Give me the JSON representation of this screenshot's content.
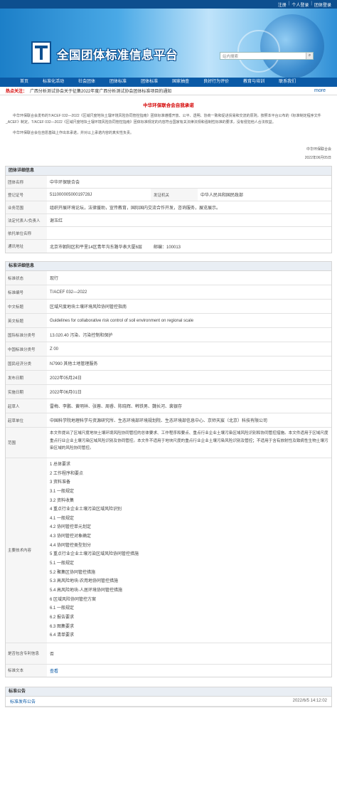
{
  "top_links": [
    "注册",
    "个人登录",
    "团体登录"
  ],
  "site_title": "全国团体标准信息平台",
  "search": {
    "placeholder": "站内搜索"
  },
  "nav": [
    "首页",
    "标准化活动",
    "社会团体",
    "团体标准",
    "团体标准",
    "国家抽查",
    "良好行为评价",
    "教育与培训",
    "联系我们"
  ],
  "hot": {
    "label": "热点关注：",
    "text": "广西分析测试协会关于征集2022年度广西分析测试协会团体标准项目的通知",
    "more": "more"
  },
  "pledge": {
    "title": "中华环保联合会自我承诺",
    "p1": "中华环保联合会发布的T/ACEF 032—2022《区域尺度地块土壤环境风险协同管控指南》团体标准遵循开放、公平、透明、协商一致和促进贸易和交流的原则，按照本平台公布的《标准制定程序文件_ACEF》制定。T/ACEF 032—2022《区域尺度地块土壤环境风险协同管控指南》团体标准规定的内容符合国家有关法律法规和强制性标准的要求，没有侵犯他人合法权益。",
    "p2": "中华环保联合会在自愿基础上作出本承诺，并对以上承诺内容的真实性负责。",
    "org": "中华环保联合会",
    "date": "2022年06月05日"
  },
  "group_info": {
    "title": "团体详细信息",
    "rows": [
      {
        "k": "团体名称",
        "v": "中华环保联合会"
      },
      {
        "k": "登记证号",
        "v": "51100000500019728J",
        "k2": "发证机关",
        "v2": "中华人民共和国民政部"
      },
      {
        "k": "业务范围",
        "v": "组织开展环境论坛，法律援助，宣传教育，国际国内交流合作开发，咨询服务，展览展示。"
      },
      {
        "k": "法定代表人/负责人",
        "v": "谢玉红"
      },
      {
        "k": "依托单位名称",
        "v": ""
      },
      {
        "k": "通讯地址",
        "v": "北京市朝阳区和平里14区青年沟东路华表大厦6层",
        "k2": "邮编：100013",
        "v2": ""
      }
    ]
  },
  "std_info": {
    "title": "标准详细信息",
    "rows": [
      {
        "k": "标准状态",
        "v": "现行"
      },
      {
        "k": "标准编号",
        "v": "T/ACEF 032—2022"
      },
      {
        "k": "中文标题",
        "v": "区域尺度地块土壤环境风险协同管控指南"
      },
      {
        "k": "英文标题",
        "v": "Guidelines for collaborative risk control of soil environment on regional scale"
      },
      {
        "k": "国际标准分类号",
        "v": "13.020.40 污染、污染控制和保护"
      },
      {
        "k": "中国标准分类号",
        "v": "Z 00"
      },
      {
        "k": "国民经济分类",
        "v": "N7990 其他土地管理服务"
      },
      {
        "k": "发布日期",
        "v": "2022年05月24日"
      },
      {
        "k": "实施日期",
        "v": "2022年06月01日"
      },
      {
        "k": "起草人",
        "v": "雷梅、李鹏、黄明祥、张蓉、周睿、陈晓辉、韩铁男、魏长河、裴银存"
      },
      {
        "k": "起草单位",
        "v": "中国科学院地理科学与资源研究所、生态环境部环境规划院、生态环境部信息中心、京师天宸（北京）科技有限公司"
      },
      {
        "k": "范围",
        "v": "本文件提出了区域尺度地块土壤环境风险协同管控的总体要求、工作程序和要点、重点行业企业土壤污染区域风险识别和协同管控措施。本文件适用于区域尺度重点行业企业土壤污染区域风险识别及协同管控。本文件不适用于地块尺度的重点行业企业土壤污染风险识别及管控；不适用于含有放射性及致病性生物土壤污染区域的风险协同管控。"
      }
    ],
    "toc_label": "主要技术内容",
    "toc": [
      "1 总体要求",
      "2 工作程序和要点",
      "3 资料准备",
      "3.1 一般规定",
      "3.2 资料收集",
      "4 重点行业企业土壤污染区域风险识别",
      "4.1 一般规定",
      "4.2 协同管控单元划定",
      "4.3 协同管控对象确定",
      "4.4 协同管控类型划分",
      "5 重点行业企业土壤污染区域风险协同管控措施",
      "5.1 一般规定",
      "5.2 聚集区协同管控措施",
      "5.3 高风险地块-农用地协同管控措施",
      "5.4 高风险地块-人居环境协同管控措施",
      "6 区域风险协同管控方案",
      "6.1 一般规定",
      "6.2 报告要求",
      "6.3 图集要求",
      "6.4 清单要求"
    ],
    "patent": {
      "k": "是否包含专利信息",
      "v": "否"
    },
    "text": {
      "k": "标准文本",
      "v": "查看"
    }
  },
  "announce": {
    "title": "标准公告",
    "item": "标准发布公告",
    "date": "2022/6/5 14:12:02"
  }
}
